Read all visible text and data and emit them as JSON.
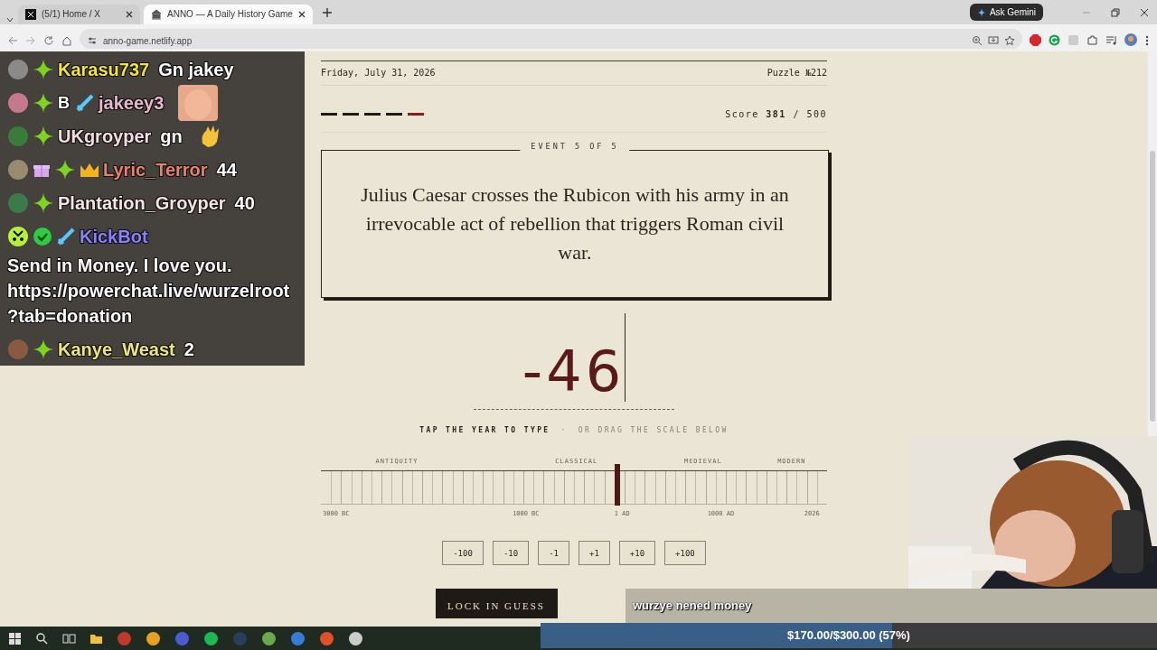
{
  "browser": {
    "tabs": [
      {
        "title": "(5/1) Home / X",
        "selected": false
      },
      {
        "title": "ANNO — A Daily History Game",
        "selected": true
      }
    ],
    "url": "anno-game.netlify.app",
    "gemini_button": "Ask Gemini"
  },
  "game": {
    "date": "Friday, July 31, 2026",
    "puzzle": "Puzzle №212",
    "progress": [
      {
        "current": false
      },
      {
        "current": false
      },
      {
        "current": false
      },
      {
        "current": false
      },
      {
        "current": true
      }
    ],
    "score": "Score **381** / 500",
    "event_label": "EVENT 5 OF 5",
    "event_text": "Julius Caesar crosses the Rubicon with his army in an irrevocable act of rebellion that triggers Roman civil war.",
    "year": "-46",
    "hint": "TAP THE YEAR TO TYPE",
    "hint_separator": "·",
    "hint_alt": "OR DRAG THE SCALE BELOW",
    "eras": [
      "ANTIQUITY",
      "CLASSICAL",
      "MEDIEVAL",
      "MODERN"
    ],
    "scale": {
      "level": 0.586,
      "labels": [
        "3000 BC",
        "1000 BC",
        "1 AD",
        "1000 AD",
        "2026"
      ]
    },
    "steps": [
      "-100",
      "-10",
      "-1",
      "+1",
      "+10",
      "+100"
    ],
    "lock_button": "LOCK IN GUESS"
  },
  "chat": [
    {
      "user": "Karasu737",
      "color": "#f2e43c",
      "badges": [
        {
          "kind": "sub"
        }
      ],
      "message": "Gn jakey"
    },
    {
      "user": "jakeey3",
      "color": "#e9b7cc",
      "badges": [
        {
          "kind": "sub"
        },
        {
          "kind": "label",
          "text": "B"
        },
        {
          "kind": "sword"
        }
      ],
      "emote": true
    },
    {
      "user": "UKgroyper",
      "color": "#f3dde3",
      "badges": [
        {
          "kind": "sub"
        }
      ],
      "message": "gn",
      "emote": true
    },
    {
      "user": "Lyric_Terror",
      "color": "#e8806c",
      "badges": [
        {
          "kind": "gift"
        },
        {
          "kind": "sub"
        },
        {
          "kind": "crown"
        }
      ],
      "message": "44"
    },
    {
      "user": "Plantation_Groyper",
      "color": "#f3e3e3",
      "badges": [
        {
          "kind": "sub"
        }
      ],
      "message": "40"
    },
    {
      "user": "KickBot",
      "color": "#8a80ff",
      "badges": [
        {
          "kind": "verified"
        },
        {
          "kind": "sword"
        }
      ],
      "bot": true,
      "message": "Send in Money. I love you. https://powerchat.live/wurzelroot?tab=donation"
    },
    {
      "user": "Kanye_Weast",
      "color": "#ece57a",
      "badges": [
        {
          "kind": "sub"
        }
      ],
      "message": "2"
    }
  ],
  "alert": "wurzye nened money",
  "goal": {
    "text": "$170.00/$300.00 (57%)",
    "level": 0.57
  }
}
